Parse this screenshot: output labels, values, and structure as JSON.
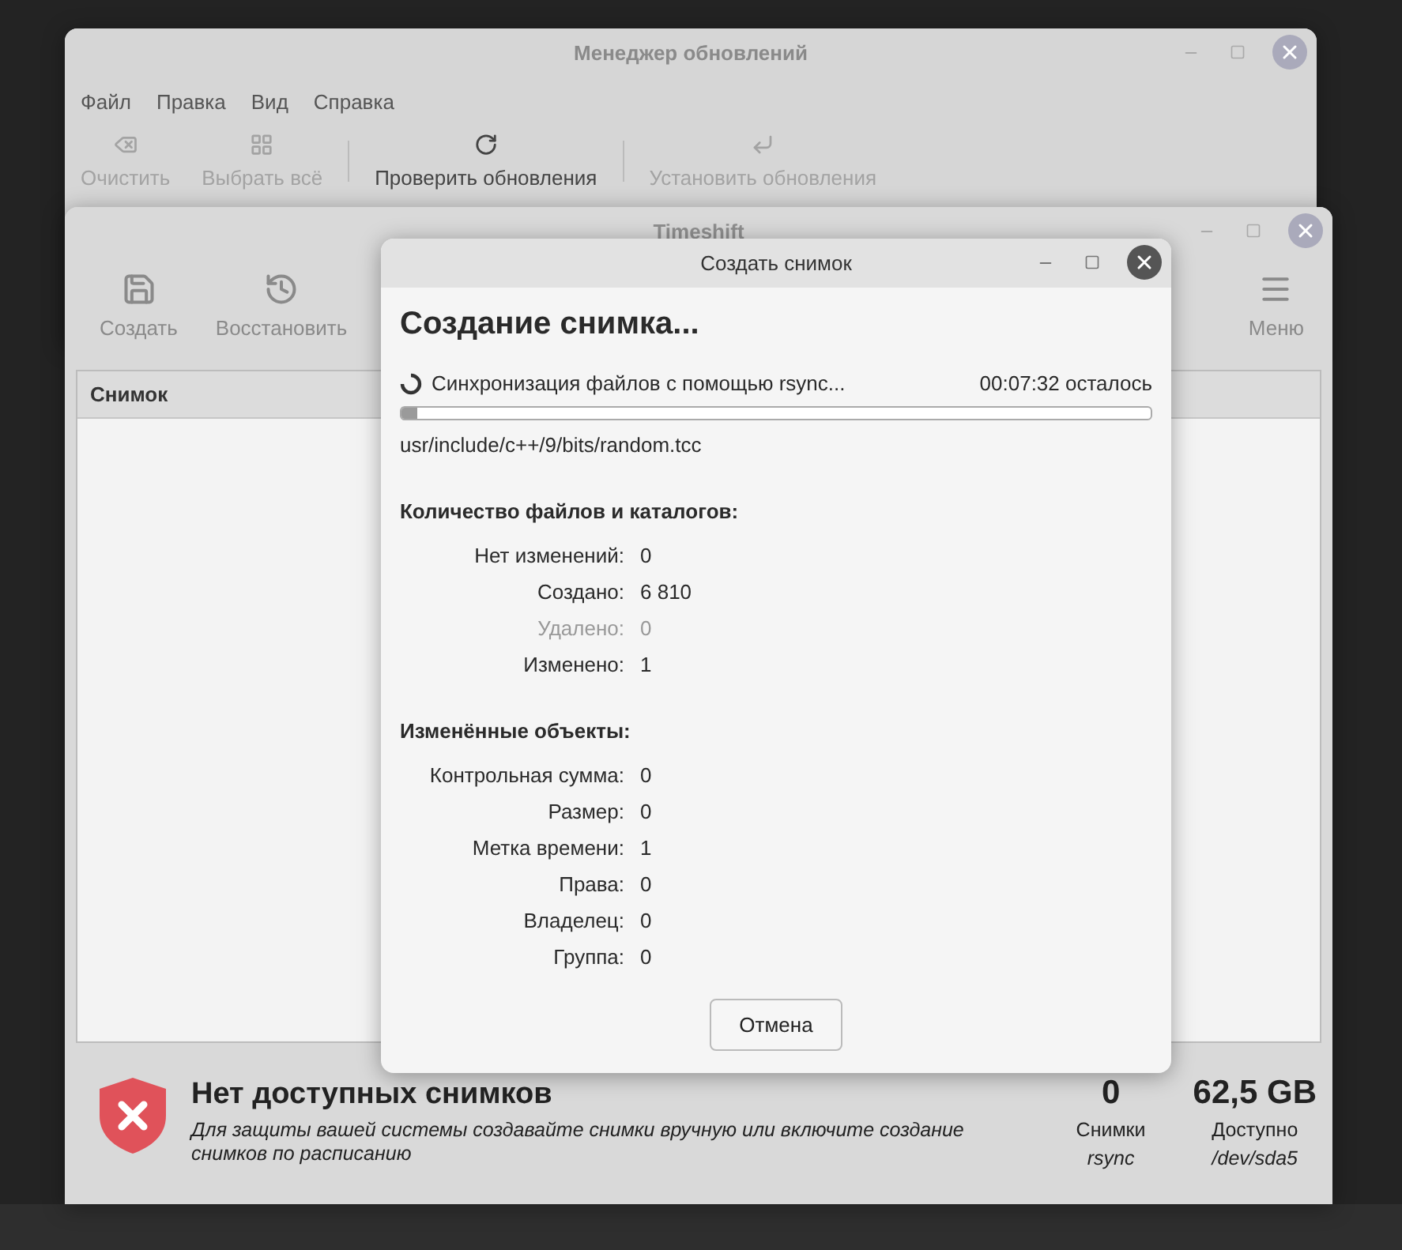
{
  "update_manager": {
    "title": "Менеджер обновлений",
    "menu": [
      "Файл",
      "Правка",
      "Вид",
      "Справка"
    ],
    "toolbar": [
      [
        {
          "label": "Очистить",
          "disabled": true
        },
        {
          "label": "Выбрать всё",
          "disabled": true
        }
      ],
      [
        {
          "label": "Проверить обновления",
          "disabled": false
        }
      ],
      [
        {
          "label": "Установить обновления",
          "disabled": true
        }
      ]
    ]
  },
  "timeshift": {
    "title": "Timeshift",
    "toolbar": {
      "start": [
        {
          "label": "Создать"
        },
        {
          "label": "Восстановить"
        }
      ],
      "end": [
        {
          "label": "Меню"
        }
      ]
    },
    "list": {
      "columns": [
        "Снимок"
      ]
    },
    "status": {
      "heading": "Нет доступных снимков",
      "message": "Для защиты вашей системы создавайте снимки вручную или включите создание снимков по расписанию",
      "stats": [
        {
          "value": "0",
          "label": "Снимки",
          "detail": "rsync"
        },
        {
          "value": "62,5 GB",
          "label": "Доступно",
          "detail": "/dev/sda5"
        }
      ]
    }
  },
  "dialog": {
    "title": "Создать снимок",
    "heading": "Создание снимка...",
    "task": {
      "text": "Синхронизация файлов с помощью rsync...",
      "remaining": "00:07:32 осталось",
      "level": 0.022
    },
    "current_file": "usr/include/c++/9/bits/random.tcc",
    "sections": [
      {
        "title": "Количество файлов и каталогов:",
        "rows": [
          {
            "label": "Нет изменений:",
            "value": "0",
            "disabled": false
          },
          {
            "label": "Создано:",
            "value": "6 810",
            "disabled": false
          },
          {
            "label": "Удалено:",
            "value": "0",
            "disabled": true
          },
          {
            "label": "Изменено:",
            "value": "1",
            "disabled": false
          }
        ]
      },
      {
        "title": "Изменённые объекты:",
        "rows": [
          {
            "label": "Контрольная сумма:",
            "value": "0",
            "disabled": false
          },
          {
            "label": "Размер:",
            "value": "0",
            "disabled": false
          },
          {
            "label": "Метка времени:",
            "value": "1",
            "disabled": false
          },
          {
            "label": "Права:",
            "value": "0",
            "disabled": false
          },
          {
            "label": "Владелец:",
            "value": "0",
            "disabled": false
          },
          {
            "label": "Группа:",
            "value": "0",
            "disabled": false
          }
        ]
      }
    ],
    "buttons": [
      "Отмена"
    ]
  }
}
